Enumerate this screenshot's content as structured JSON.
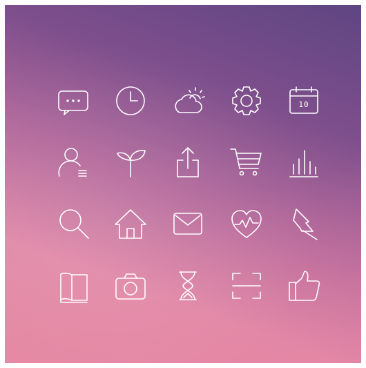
{
  "icons": [
    {
      "name": "chat-bubble-icon"
    },
    {
      "name": "clock-icon"
    },
    {
      "name": "weather-partly-cloudy-icon"
    },
    {
      "name": "gear-icon"
    },
    {
      "name": "calendar-icon",
      "label": "10"
    },
    {
      "name": "user-icon"
    },
    {
      "name": "sprout-icon"
    },
    {
      "name": "share-upload-icon"
    },
    {
      "name": "shopping-cart-icon"
    },
    {
      "name": "bar-chart-icon"
    },
    {
      "name": "search-icon"
    },
    {
      "name": "home-icon"
    },
    {
      "name": "mail-icon"
    },
    {
      "name": "heart-pulse-icon"
    },
    {
      "name": "pushpin-icon"
    },
    {
      "name": "book-icon"
    },
    {
      "name": "camera-icon"
    },
    {
      "name": "hourglass-icon"
    },
    {
      "name": "scan-frame-icon"
    },
    {
      "name": "thumbs-up-icon"
    }
  ],
  "colors": {
    "icon_stroke": "#ffffff",
    "gradient_top": "#5e4582",
    "gradient_bottom": "#e58aa4"
  }
}
